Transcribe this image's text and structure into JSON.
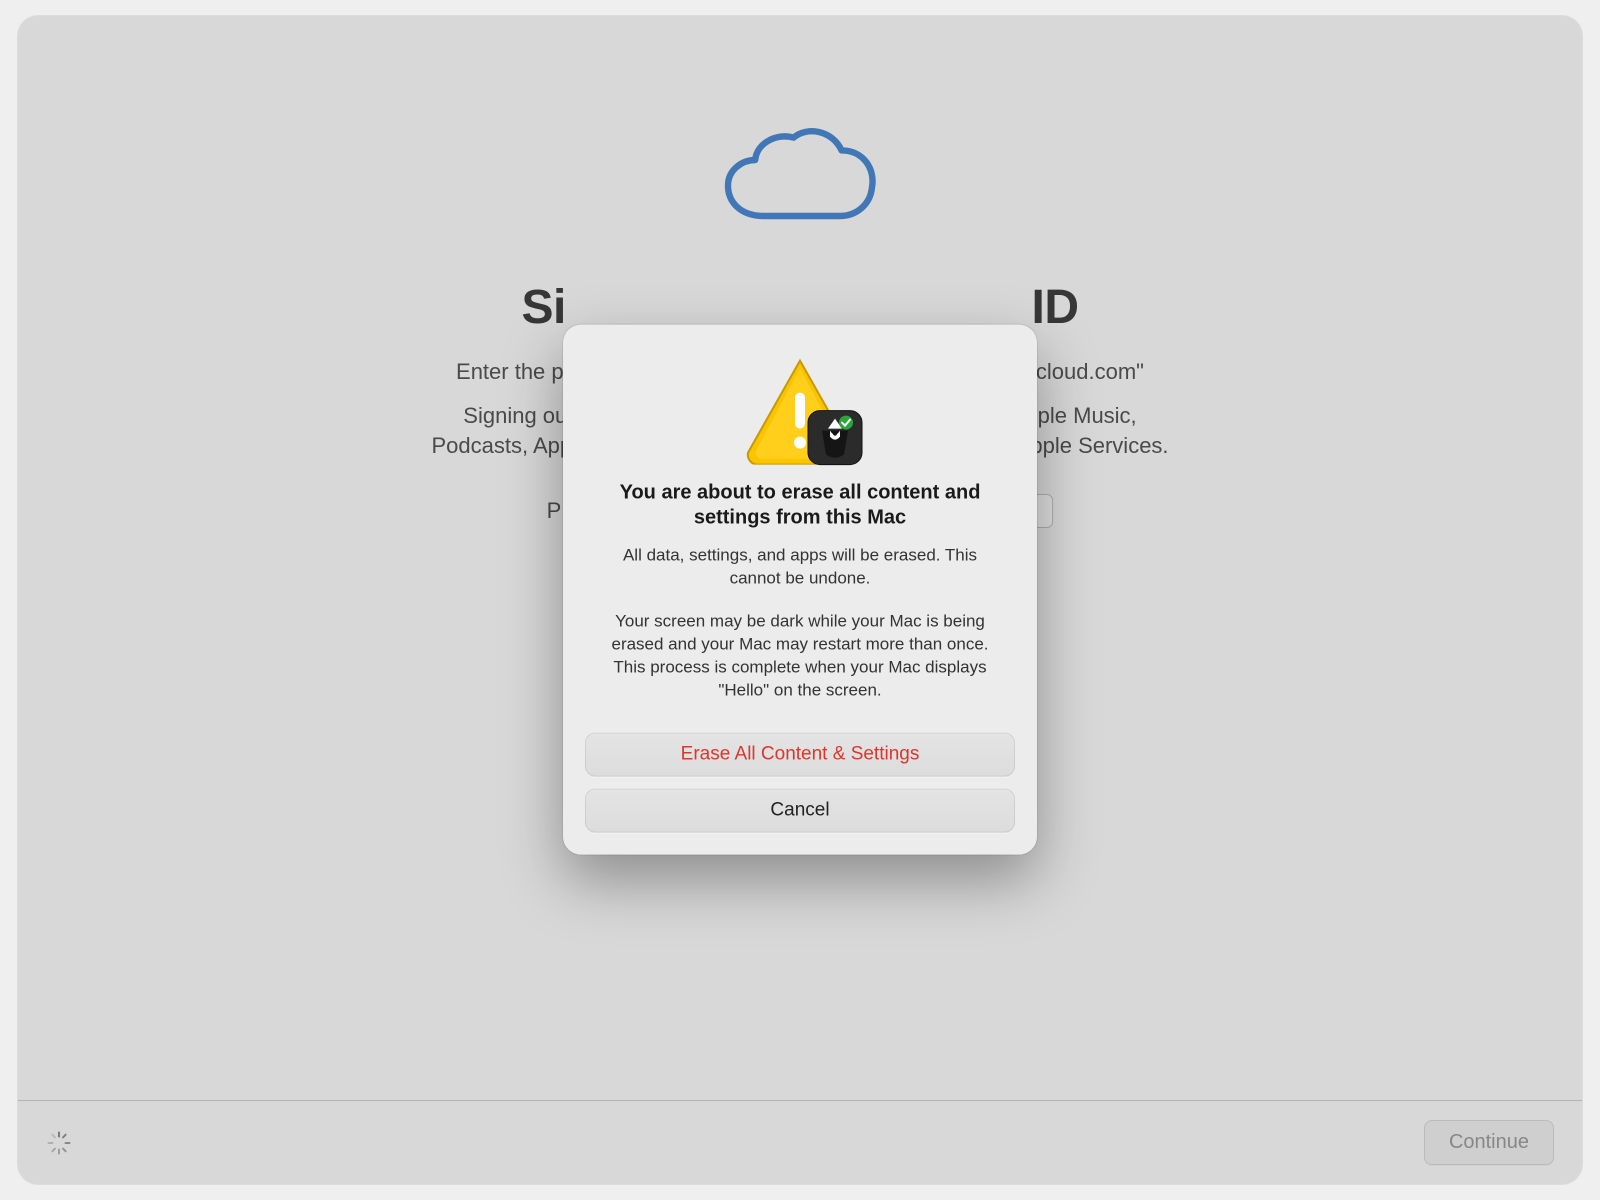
{
  "background": {
    "title_prefix": "Si",
    "title_suffix": "ID",
    "prompt_line_prefix": "Enter the p",
    "prompt_line_suffix": "cloud.com\"",
    "desc_prefix": "Signing out",
    "desc_mid_right": "ple Music,",
    "desc_line2_left": "Podcasts, App",
    "desc_line2_right": "pple Services.",
    "password_label_visible_prefix": "P",
    "continue_label": "Continue"
  },
  "modal": {
    "title": "You are about to erase all content and settings from this Mac",
    "body1": "All data, settings, and apps will be erased. This cannot be undone.",
    "body2": "Your screen may be dark while your Mac is being erased and your Mac may restart more than once. This process is complete when your Mac displays \"Hello\" on the screen.",
    "erase_label": "Erase All Content & Settings",
    "cancel_label": "Cancel"
  },
  "colors": {
    "destructive": "#e0352b",
    "cloud_stroke": "#4a88d0"
  }
}
